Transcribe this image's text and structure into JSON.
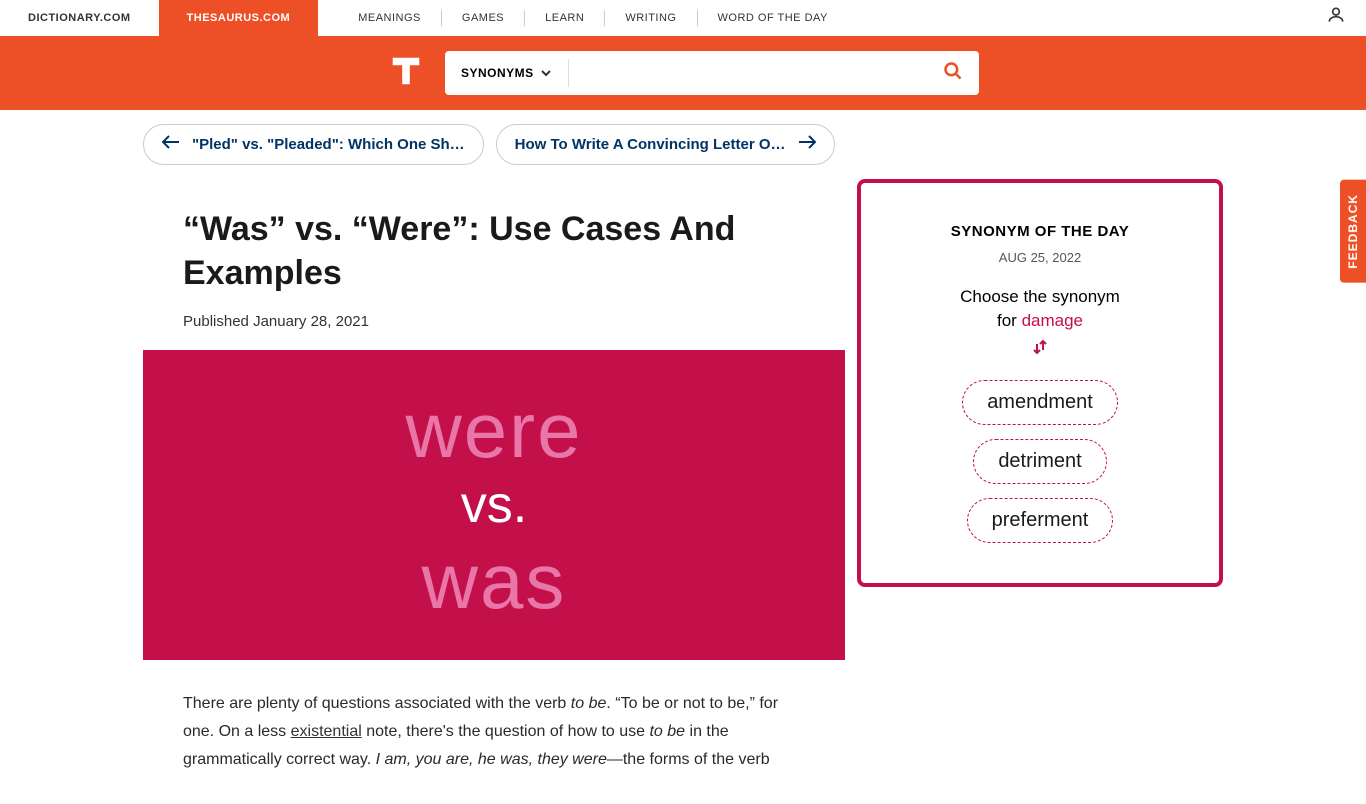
{
  "nav": {
    "dictionary_tab": "DICTIONARY.COM",
    "thesaurus_tab": "THESAURUS.COM",
    "links": [
      "MEANINGS",
      "GAMES",
      "LEARN",
      "WRITING",
      "WORD OF THE DAY"
    ]
  },
  "search": {
    "dropdown_label": "SYNONYMS",
    "placeholder": ""
  },
  "article_nav": {
    "prev": "\"Pled\" vs. \"Pleaded\": Which One Sh…",
    "next": "How To Write A Convincing Letter O…"
  },
  "article": {
    "title": "“Was” vs. “Were”: Use Cases And Examples",
    "published_prefix": "Published ",
    "published_date": "January 28, 2021",
    "hero": {
      "were": "were",
      "vs": "vs.",
      "was": "was"
    },
    "body_1": "There are plenty of questions associated with the verb ",
    "body_em1": "to be",
    "body_2": ". “To be or not to be,” for one. On a less ",
    "body_link": "existential",
    "body_3": " note, there's the question of how to use ",
    "body_em2": "to be",
    "body_4": " in the grammatically correct way. ",
    "body_em3": "I am, you are, he was, they were",
    "body_5": "—the forms of the verb"
  },
  "sidebar": {
    "title": "SYNONYM OF THE DAY",
    "date": "AUG 25, 2022",
    "prompt_1": "Choose the synonym",
    "prompt_2": "for ",
    "word": "damage",
    "options": [
      "amendment",
      "detriment",
      "preferment"
    ]
  },
  "feedback": "FEEDBACK"
}
